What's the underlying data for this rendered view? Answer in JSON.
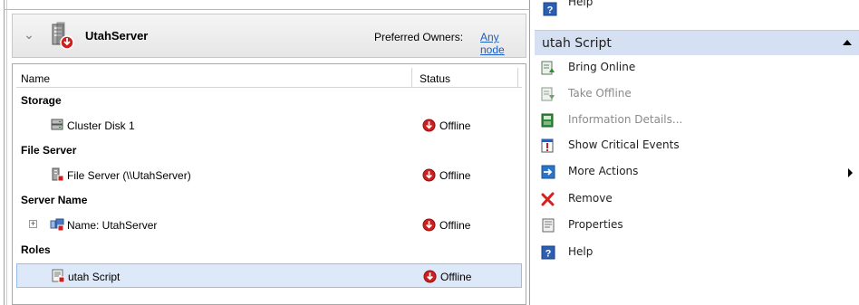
{
  "server": {
    "name": "UtahServer",
    "preferred_owners_label": "Preferred Owners:",
    "preferred_owners_link": "Any node"
  },
  "grid": {
    "columns": {
      "name": "Name",
      "status": "Status"
    },
    "groups": {
      "storage": "Storage",
      "file_server": "File Server",
      "server_name": "Server Name",
      "roles": "Roles"
    },
    "rows": {
      "cluster_disk": {
        "name": "Cluster Disk 1",
        "status": "Offline"
      },
      "file_server": {
        "name": "File Server (\\\\UtahServer)",
        "status": "Offline"
      },
      "name_resource": {
        "name": "Name: UtahServer",
        "status": "Offline"
      },
      "script": {
        "name": "utah Script",
        "status": "Offline"
      }
    }
  },
  "actions": {
    "top_help": "Help",
    "section_title": "utah Script",
    "items": {
      "bring_online": "Bring Online",
      "take_offline": "Take Offline",
      "information_details": "Information Details...",
      "show_critical_events": "Show Critical Events",
      "more_actions": "More Actions",
      "remove": "Remove",
      "properties": "Properties",
      "help": "Help"
    }
  },
  "colors": {
    "section_bg": "#d5e1f2",
    "link": "#1a5ec8",
    "selection_bg": "#dde9f8",
    "offline_red": "#cc1f1f"
  }
}
